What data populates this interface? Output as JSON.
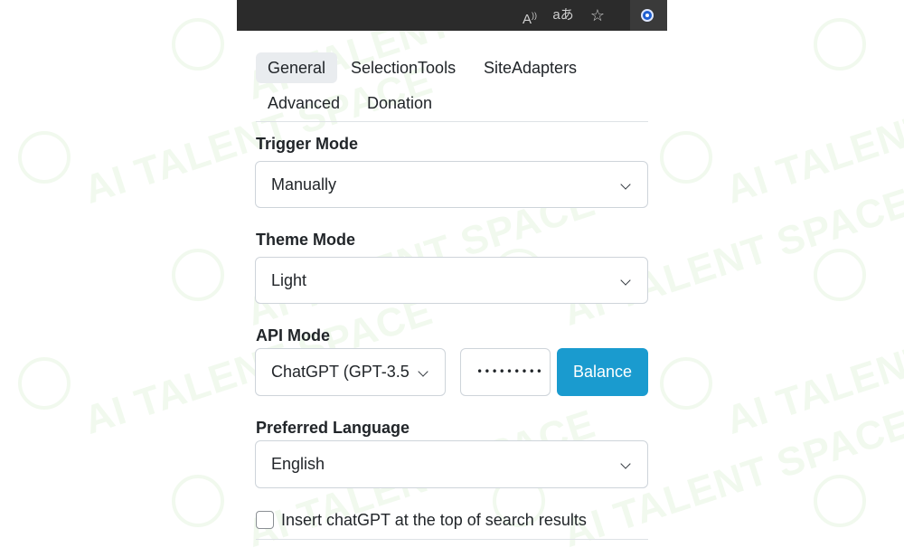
{
  "toolbar": {
    "read_aloud_icon": "A )",
    "translate_icon": "aあ",
    "favorites_icon": "☆"
  },
  "tabs": [
    {
      "label": "General",
      "active": true
    },
    {
      "label": "SelectionTools",
      "active": false
    },
    {
      "label": "SiteAdapters",
      "active": false
    },
    {
      "label": "Advanced",
      "active": false
    },
    {
      "label": "Donation",
      "active": false
    }
  ],
  "trigger_mode": {
    "label": "Trigger Mode",
    "value": "Manually"
  },
  "theme_mode": {
    "label": "Theme Mode",
    "value": "Light"
  },
  "api_mode": {
    "label": "API Mode",
    "value": "ChatGPT (GPT-3.5",
    "api_key_masked": "•••••••••",
    "balance_label": "Balance"
  },
  "preferred_language": {
    "label": "Preferred Language",
    "value": "English"
  },
  "insert_option": {
    "label": "Insert chatGPT at the top of search results",
    "checked": false
  },
  "watermark": {
    "text": "AI TALENT SPACE"
  },
  "colors": {
    "accent": "#1a9bcf",
    "toolbar": "#2b2b2b",
    "tab_active": "#e9ecef"
  }
}
